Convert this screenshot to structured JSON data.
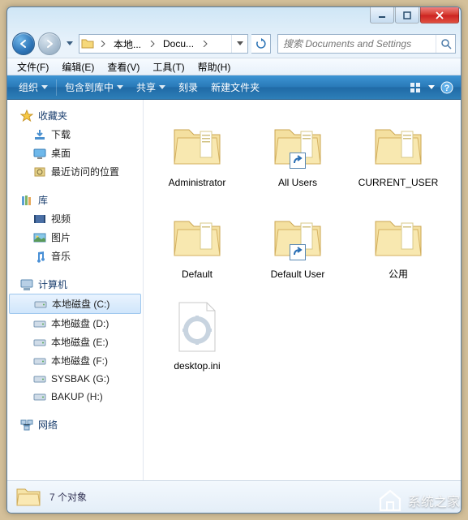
{
  "breadcrumb": {
    "seg1": "本地...",
    "seg2": "Docu..."
  },
  "search": {
    "placeholder": "搜索 Documents and Settings"
  },
  "menu": {
    "file": "文件(F)",
    "edit": "编辑(E)",
    "view": "查看(V)",
    "tools": "工具(T)",
    "help": "帮助(H)"
  },
  "toolbar": {
    "organize": "组织",
    "include": "包含到库中",
    "share": "共享",
    "burn": "刻录",
    "newfolder": "新建文件夹"
  },
  "sidebar": {
    "favorites": {
      "head": "收藏夹",
      "downloads": "下载",
      "desktop": "桌面",
      "recent": "最近访问的位置"
    },
    "libraries": {
      "head": "库",
      "videos": "视频",
      "pictures": "图片",
      "music": "音乐"
    },
    "computer": {
      "head": "计算机",
      "c": "本地磁盘 (C:)",
      "d": "本地磁盘 (D:)",
      "e": "本地磁盘 (E:)",
      "f": "本地磁盘 (F:)",
      "g": "SYSBAK (G:)",
      "h": "BAKUP (H:)"
    },
    "network": {
      "head": "网络"
    }
  },
  "items": {
    "0": {
      "label": "Administrator"
    },
    "1": {
      "label": "All Users"
    },
    "2": {
      "label": "CURRENT_USER"
    },
    "3": {
      "label": "Default"
    },
    "4": {
      "label": "Default User"
    },
    "5": {
      "label": "公用"
    },
    "6": {
      "label": "desktop.ini"
    }
  },
  "status": {
    "text": "7 个对象"
  },
  "watermark": "系统之家"
}
